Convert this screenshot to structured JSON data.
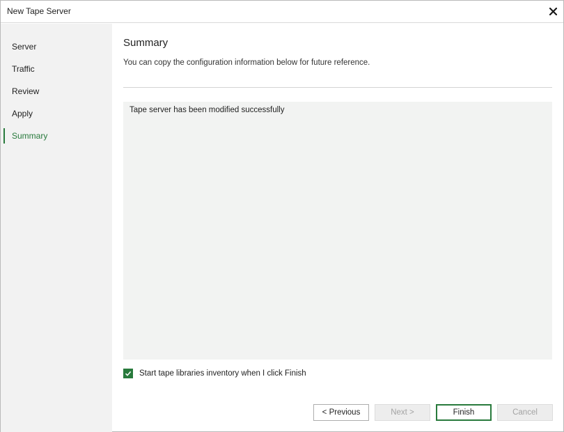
{
  "window": {
    "title": "New Tape Server",
    "close_icon": "close-icon"
  },
  "sidebar": {
    "items": [
      {
        "label": "Server",
        "active": false
      },
      {
        "label": "Traffic",
        "active": false
      },
      {
        "label": "Review",
        "active": false
      },
      {
        "label": "Apply",
        "active": false
      },
      {
        "label": "Summary",
        "active": true
      }
    ]
  },
  "main": {
    "title": "Summary",
    "subtitle": "You can copy the configuration information below for future reference.",
    "summary_text": "Tape server has been modified successfully",
    "inventory_checkbox": {
      "label": "Start tape libraries inventory when I click Finish",
      "checked": true
    }
  },
  "buttons": {
    "previous": "< Previous",
    "next": "Next >",
    "finish": "Finish",
    "cancel": "Cancel"
  },
  "colors": {
    "accent": "#287a3c",
    "sidebar_bg": "#f2f2f2",
    "summary_bg": "#f2f3f2"
  }
}
